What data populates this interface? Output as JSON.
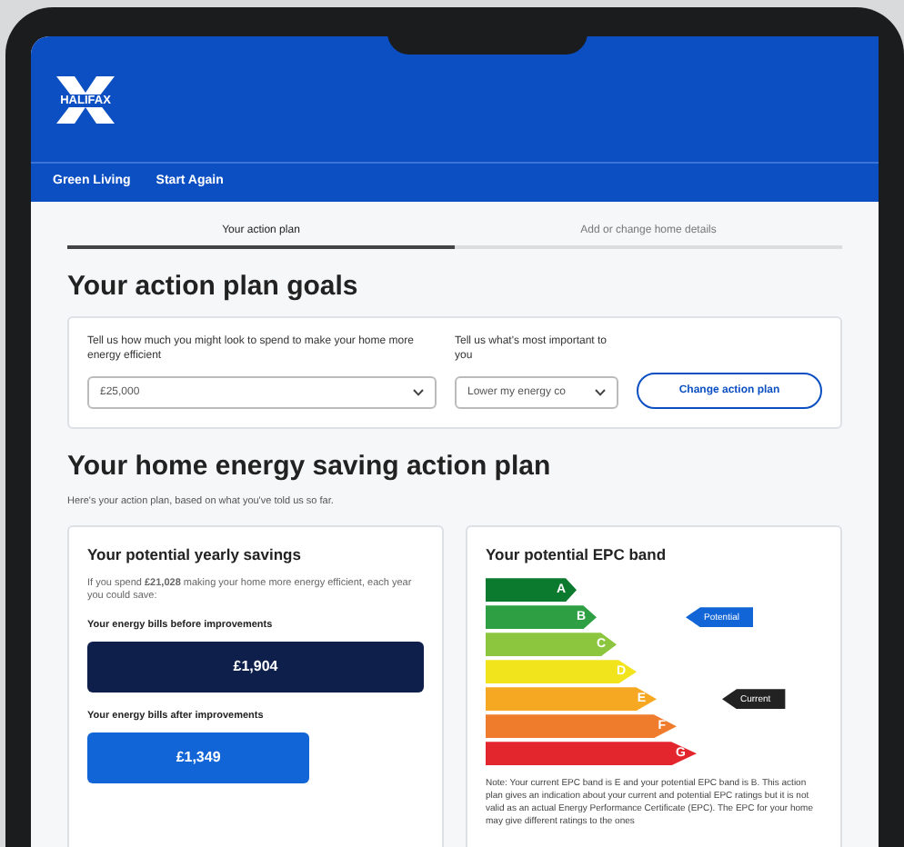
{
  "header": {
    "logo": "HALIFAX",
    "nav": [
      "Green Living",
      "Start Again"
    ]
  },
  "tabs": [
    {
      "label": "Your action plan",
      "selected": true
    },
    {
      "label": "Add or change home details",
      "selected": false
    }
  ],
  "goals": {
    "title": "Your action plan goals",
    "spend": {
      "label": "Tell us how much you might look to spend to make your home more energy efficient",
      "value": "£25,000"
    },
    "priority": {
      "label": "Tell us what's most important to you",
      "value": "Lower my energy co"
    },
    "button": "Change action plan"
  },
  "plan": {
    "title": "Your home energy saving action plan",
    "intro": "Here's your action plan, based on what you've told us so far.",
    "savings": {
      "title": "Your potential yearly savings",
      "text": "If you spend **£21,028** making your home more energy efficient, each year you could save:",
      "before_label": "Your energy bills before improvements",
      "before_value": "£1,904",
      "after_label": "Your energy bills after improvements",
      "after_value": "£1,349"
    },
    "epc": {
      "title": "Your potential EPC band",
      "bands": [
        {
          "letter": "A",
          "color": "#0b7a2e"
        },
        {
          "letter": "B",
          "color": "#2ea043",
          "marker": {
            "kind": "potential",
            "label": "Potential"
          }
        },
        {
          "letter": "C",
          "color": "#8cc63e"
        },
        {
          "letter": "D",
          "color": "#f2e41c"
        },
        {
          "letter": "E",
          "color": "#f7a823",
          "marker": {
            "kind": "current",
            "label": "Current"
          }
        },
        {
          "letter": "F",
          "color": "#ef7b2d"
        },
        {
          "letter": "G",
          "color": "#e3262d"
        }
      ],
      "note": "Note: Your current EPC band is E and your potential EPC band is B. This action plan gives an indication about your current and potential EPC ratings but it is not valid as an actual Energy Performance Certificate (EPC). The EPC for your home may give different ratings to the ones"
    }
  }
}
